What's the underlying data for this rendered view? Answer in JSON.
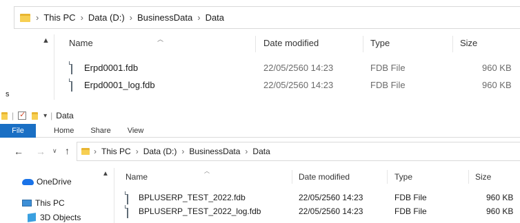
{
  "top_window": {
    "breadcrumb": [
      "This PC",
      "Data (D:)",
      "BusinessData",
      "Data"
    ],
    "columns": [
      "Name",
      "Date modified",
      "Type",
      "Size"
    ],
    "files": [
      {
        "name": "Erpd0001.fdb",
        "date": "22/05/2560 14:23",
        "type": "FDB File",
        "size": "960 KB"
      },
      {
        "name": "Erpd0001_log.fdb",
        "date": "22/05/2560 14:23",
        "type": "FDB File",
        "size": "960 KB"
      }
    ],
    "left_fragment": "s"
  },
  "bottom_window": {
    "title": "Data",
    "tabs": {
      "file": "File",
      "home": "Home",
      "share": "Share",
      "view": "View"
    },
    "breadcrumb": [
      "This PC",
      "Data (D:)",
      "BusinessData",
      "Data"
    ],
    "sidebar": [
      {
        "label": "OneDrive",
        "icon": "onedrive-icon"
      },
      {
        "label": "This PC",
        "icon": "this-pc-icon"
      },
      {
        "label": "3D Objects",
        "icon": "3d-objects-icon"
      }
    ],
    "columns": [
      "Name",
      "Date modified",
      "Type",
      "Size"
    ],
    "files": [
      {
        "name": "BPLUSERP_TEST_2022.fdb",
        "date": "22/05/2560 14:23",
        "type": "FDB File",
        "size": "960 KB"
      },
      {
        "name": "BPLUSERP_TEST_2022_log.fdb",
        "date": "22/05/2560 14:23",
        "type": "FDB File",
        "size": "960 KB"
      }
    ]
  },
  "colors": {
    "accent": "#1a6fc4",
    "folder": "#f7cf52",
    "onedrive": "#1a73e8"
  }
}
